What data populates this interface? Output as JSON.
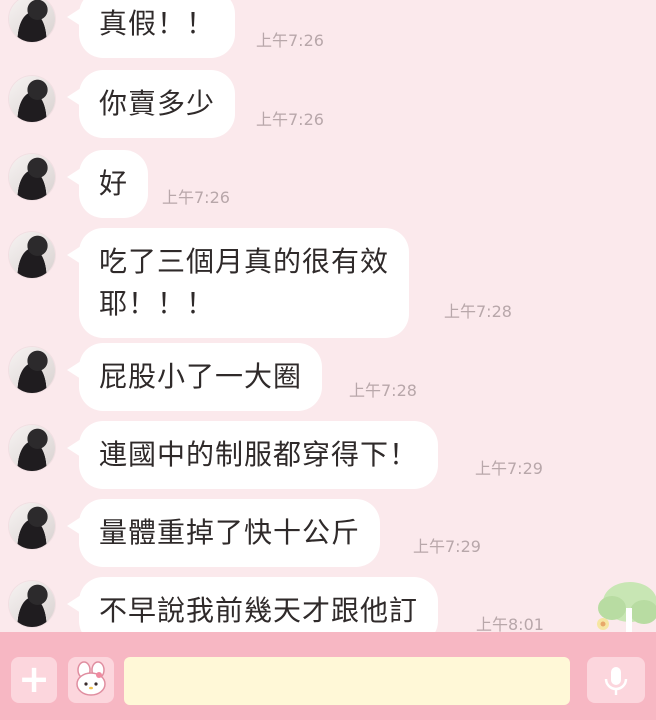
{
  "messages": [
    {
      "text": "真假！！",
      "time": "上午7:26"
    },
    {
      "text": "你賣多少",
      "time": "上午7:26"
    },
    {
      "text": "好",
      "time": "上午7:26"
    },
    {
      "text": "吃了三個月真的很有效\n耶！！！",
      "time": "上午7:28"
    },
    {
      "text": "屁股小了一大圈",
      "time": "上午7:28"
    },
    {
      "text": "連國中的制服都穿得下！",
      "time": "上午7:29"
    },
    {
      "text": "量體重掉了快十公斤",
      "time": "上午7:29"
    },
    {
      "text": "不早說我前幾天才跟他訂",
      "time": "上午8:01"
    }
  ],
  "input": {
    "value": "",
    "placeholder": ""
  },
  "colors": {
    "background": "#fbe9ec",
    "bubble": "#ffffff",
    "bottom_bar": "#f7b7c3",
    "input_field": "#fff8d7",
    "timestamp": "#b8a7aa"
  },
  "icons": {
    "add": "plus-icon",
    "sticker": "melody-sticker-icon",
    "voice": "microphone-icon",
    "decoration": "tree-icon"
  }
}
